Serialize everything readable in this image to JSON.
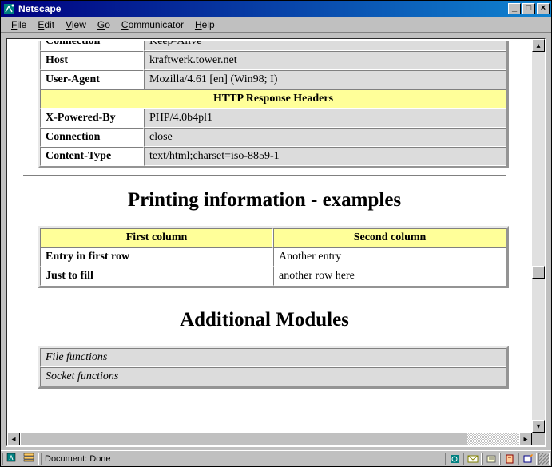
{
  "window": {
    "title": "Netscape",
    "min": "_",
    "max": "□",
    "close": "×"
  },
  "menu": {
    "file": "File",
    "edit": "Edit",
    "view": "View",
    "go": "Go",
    "communicator": "Communicator",
    "help": "Help"
  },
  "status": {
    "text": "Document: Done"
  },
  "headers_table": {
    "partial_row_label": "Connection",
    "partial_row_value": "Keep-Alive",
    "rows": [
      {
        "label": "Host",
        "value": "kraftwerk.tower.net"
      },
      {
        "label": "User-Agent",
        "value": "Mozilla/4.61 [en] (Win98; I)"
      }
    ],
    "section_title": "HTTP Response Headers",
    "response_rows": [
      {
        "label": "X-Powered-By",
        "value": "PHP/4.0b4pl1"
      },
      {
        "label": "Connection",
        "value": "close"
      },
      {
        "label": "Content-Type",
        "value": "text/html;charset=iso-8859-1"
      }
    ]
  },
  "printing": {
    "heading": "Printing information - examples",
    "cols": {
      "c1": "First column",
      "c2": "Second column"
    },
    "rows": [
      {
        "c1": "Entry in first row",
        "c2": "Another entry"
      },
      {
        "c1": "Just to fill",
        "c2": "another row here"
      }
    ]
  },
  "modules": {
    "heading": "Additional Modules",
    "items": [
      "File functions",
      "Socket functions"
    ]
  }
}
